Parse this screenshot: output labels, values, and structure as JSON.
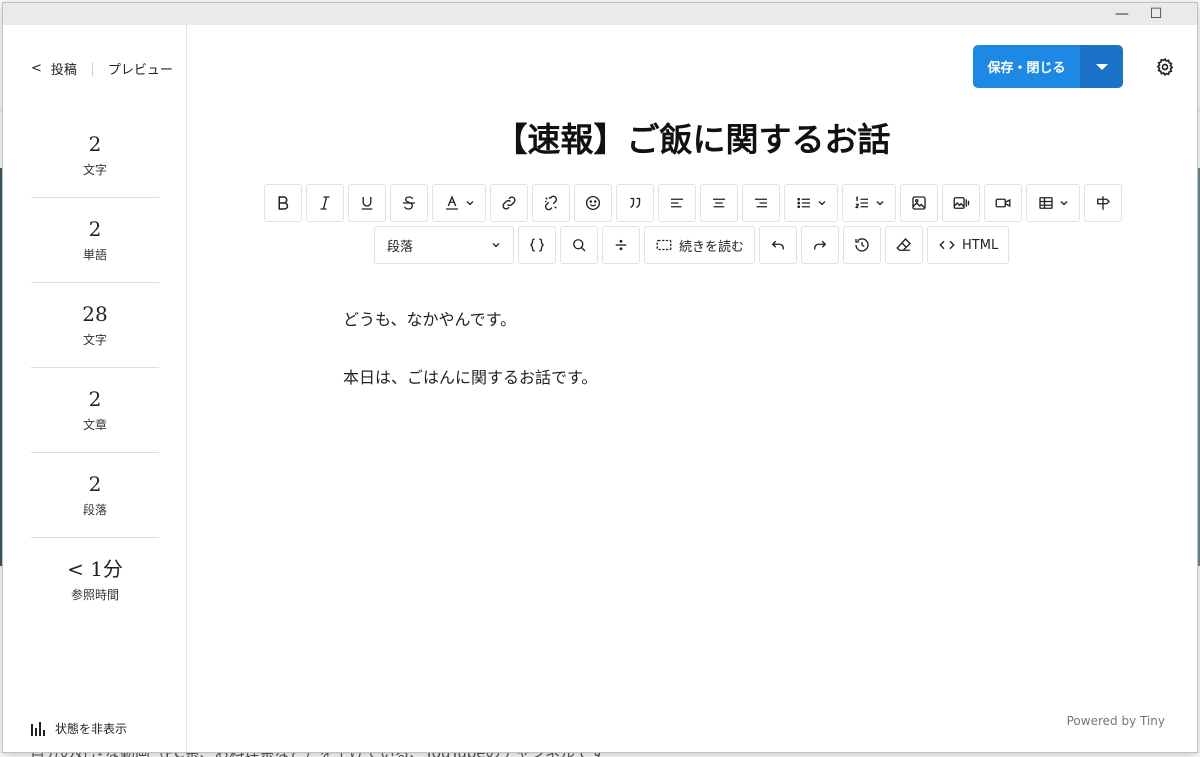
{
  "background": {
    "bottom_text": "自分の好きな動画（PC系、お料理系など）を上げている、YouTubeのチャンネルです"
  },
  "window": {
    "minimize_glyph": "—",
    "maximize_glyph": "☐"
  },
  "sidebar": {
    "back_label": "投稿",
    "preview_label": "プレビュー",
    "stats": [
      {
        "value": "2",
        "label": "文字"
      },
      {
        "value": "2",
        "label": "単語"
      },
      {
        "value": "28",
        "label": "文字"
      },
      {
        "value": "2",
        "label": "文章"
      },
      {
        "value": "2",
        "label": "段落"
      },
      {
        "value": "< 1分",
        "label": "参照時間"
      }
    ],
    "hide_stats_label": "状態を非表示"
  },
  "header": {
    "save_label": "保存・閉じる",
    "accent_color": "#1e88e5"
  },
  "editor": {
    "title": "【速報】ご飯に関するお話",
    "block_format": "段落",
    "read_more_label": "続きを読む",
    "html_label": "HTML",
    "paragraphs": [
      "どうも、なかやんです。",
      "本日は、ごはんに関するお話です。"
    ],
    "powered_by": "Powered by Tiny"
  }
}
